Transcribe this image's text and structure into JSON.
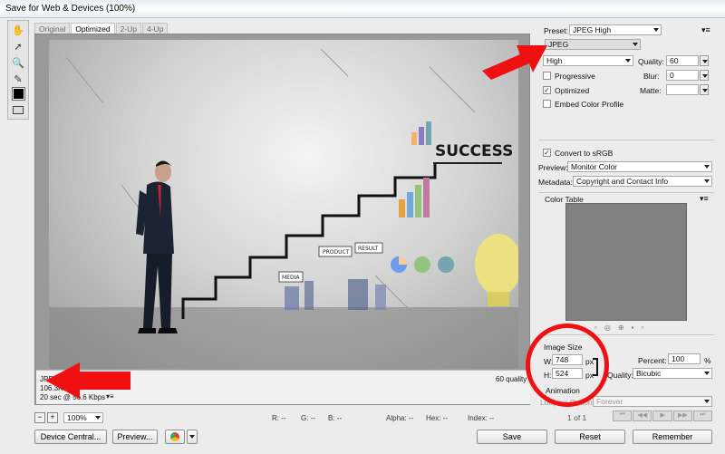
{
  "window": {
    "title": "Save for Web & Devices (100%)"
  },
  "tools": [
    "hand-icon",
    "slice-select-icon",
    "zoom-icon",
    "eyedropper-icon",
    "color-swatch",
    "toggle-slices-icon"
  ],
  "tabs": [
    "Original",
    "Optimized",
    "2-Up",
    "4-Up"
  ],
  "active_tab": "Optimized",
  "image_text": {
    "headline": "SUCCESS",
    "label_product": "PRODUCT",
    "label_result": "RESULT",
    "label_media": "MEDIA"
  },
  "info": {
    "format": "JPEG",
    "size": "106.3K",
    "time": "20 sec @ 56.6 Kbps",
    "quality": "60 quality"
  },
  "settings": {
    "preset_label": "Preset:",
    "preset_value": "JPEG High",
    "format_value": "JPEG",
    "quality_level": "High",
    "quality_label": "Quality:",
    "quality_value": "60",
    "progressive_label": "Progressive",
    "blur_label": "Blur:",
    "blur_value": "0",
    "optimized_label": "Optimized",
    "matte_label": "Matte:",
    "embed_label": "Embed Color Profile",
    "convert_label": "Convert to sRGB",
    "preview_label": "Preview:",
    "preview_value": "Monitor Color",
    "metadata_label": "Metadata:",
    "metadata_value": "Copyright and Contact Info",
    "color_table_label": "Color Table",
    "image_size_label": "Image Size",
    "width_label": "W:",
    "width_value": "748",
    "width_unit": "px",
    "height_label": "H:",
    "height_value": "524",
    "height_unit": "px",
    "percent_label": "Percent:",
    "percent_value": "100",
    "percent_unit": "%",
    "resample_label": "Quality:",
    "resample_value": "Bicubic",
    "animation_label": "Animation",
    "looping_label": "Looping Options:",
    "looping_value": "Forever",
    "frame_counter": "1 of 1"
  },
  "statusbar": {
    "zoom": "100%",
    "r": "R: --",
    "g": "G: --",
    "b": "B: --",
    "alpha": "Alpha: --",
    "hex": "Hex: --",
    "index": "Index: --"
  },
  "buttons": {
    "device_central": "Device Central...",
    "preview": "Preview...",
    "save": "Save",
    "reset": "Reset",
    "remember": "Remember"
  },
  "colors": {
    "callout_red": "#ef1111",
    "panel_bg": "#ececec",
    "frame_gray": "#9a9a9a"
  }
}
